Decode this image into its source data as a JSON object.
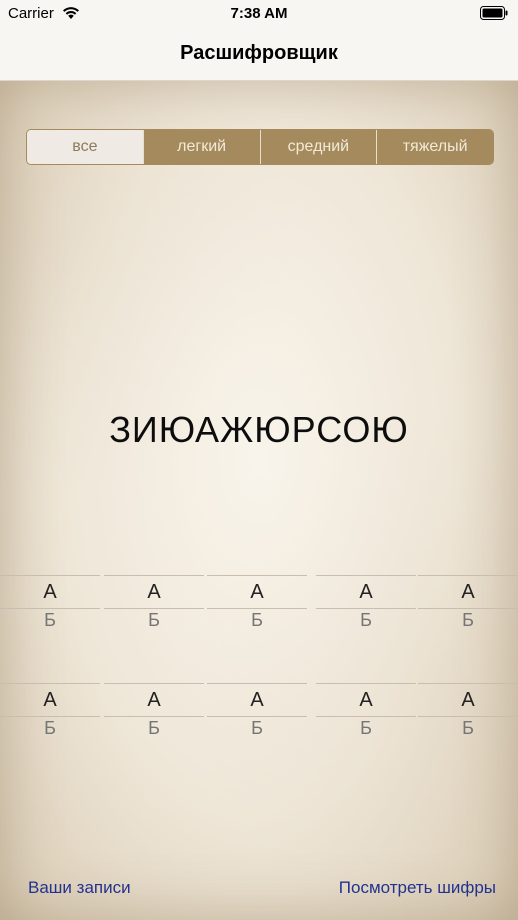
{
  "status": {
    "carrier": "Carrier",
    "time": "7:38 AM"
  },
  "nav": {
    "title": "Расшифровщик"
  },
  "difficulty": {
    "segments": [
      {
        "label": "все",
        "selected": true
      },
      {
        "label": "легкий",
        "selected": false
      },
      {
        "label": "средний",
        "selected": false
      },
      {
        "label": "тяжелый",
        "selected": false
      }
    ]
  },
  "cipher": {
    "text": "ЗИЮАЖЮРСОЮ"
  },
  "letter_rows": [
    [
      {
        "cipher": "А",
        "plain": "Б"
      },
      {
        "cipher": "А",
        "plain": "Б"
      },
      {
        "cipher": "А",
        "plain": "Б"
      },
      {
        "cipher": "А",
        "plain": "Б"
      },
      {
        "cipher": "А",
        "plain": "Б"
      }
    ],
    [
      {
        "cipher": "А",
        "plain": "Б"
      },
      {
        "cipher": "А",
        "plain": "Б"
      },
      {
        "cipher": "А",
        "plain": "Б"
      },
      {
        "cipher": "А",
        "plain": "Б"
      },
      {
        "cipher": "А",
        "plain": "Б"
      }
    ]
  ],
  "footer": {
    "records": "Ваши записи",
    "ciphers": "Посмотреть шифры"
  },
  "colors": {
    "accent": "#a48a5c",
    "link": "#23328f",
    "paper": "#ece3d3"
  },
  "icons": {
    "wifi": "wifi-icon",
    "battery": "battery-icon"
  }
}
